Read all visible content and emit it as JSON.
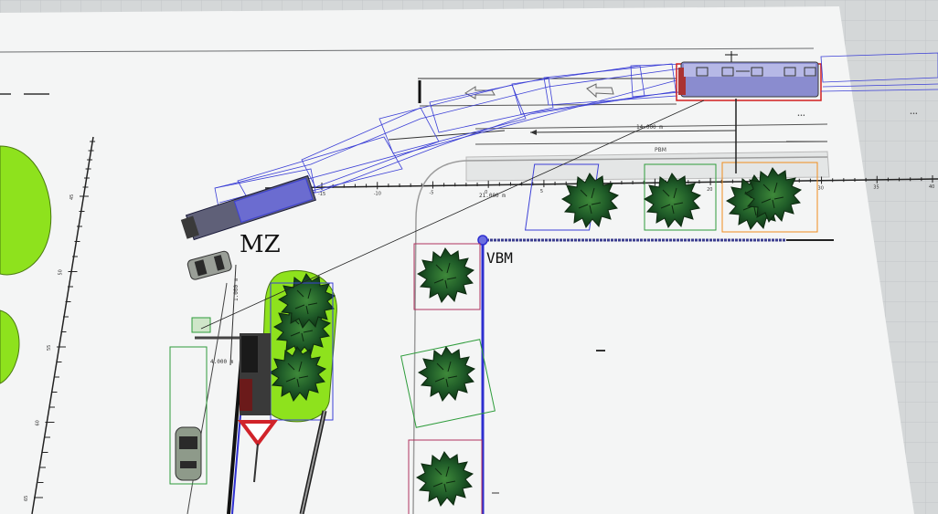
{
  "viewport": {
    "background_color": "#d4d7d8",
    "sheet_color": "#f4f5f5"
  },
  "labels": {
    "zone_mz": "MZ",
    "zone_vbm": "VBM",
    "road_marking": "PBM"
  },
  "dimensions": {
    "bus_path_length": "14.000 m",
    "crosswalk_distance": "21.000 m",
    "vertical_offset": "1.000 m",
    "vertical_length": "4.000 m"
  },
  "ruler_horizontal": {
    "ticks": [
      "-15",
      "-10",
      "-5",
      "0",
      "5",
      "10",
      "15",
      "20",
      "25",
      "30",
      "35",
      "40"
    ]
  },
  "ruler_vertical": {
    "ticks": [
      "45",
      "50",
      "55",
      "60",
      "65"
    ]
  },
  "colors": {
    "selection_blue": "#3b3fd6",
    "bus_body": "#8a8ccf",
    "bus_selected_outline": "#d11f1f",
    "grass": "#8ee21d",
    "tree_dark": "#1e5d2a",
    "tree_box_green": "#2e9c3b",
    "tree_box_magenta": "#b0325e",
    "tree_box_orange": "#f08d1e",
    "yield_red": "#d1232a"
  },
  "objects": {
    "vehicles": [
      "bus",
      "bus",
      "car",
      "car"
    ],
    "signs": [
      "yield-sign"
    ]
  }
}
